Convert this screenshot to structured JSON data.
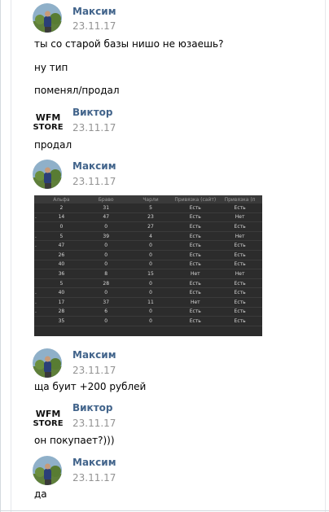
{
  "messages": [
    {
      "author": "Максим",
      "date": "23.11.17",
      "avatar": "maxim",
      "texts": [
        "ты со старой базы нишо не юзаешь?",
        "ну тип",
        "поменял/продал"
      ]
    },
    {
      "author": "Виктор",
      "date": "23.11.17",
      "avatar": "viktor",
      "texts": [
        "продал"
      ]
    },
    {
      "author": "Максим",
      "date": "23.11.17",
      "avatar": "maxim",
      "texts": []
    },
    {
      "author": "Максим",
      "date": "23.11.17",
      "avatar": "maxim",
      "texts": [
        "ща буит +200 рублей"
      ]
    },
    {
      "author": "Виктор",
      "date": "23.11.17",
      "avatar": "viktor",
      "texts": [
        "он покупает?)))"
      ]
    },
    {
      "author": "Максим",
      "date": "23.11.17",
      "avatar": "maxim",
      "texts": [
        "да"
      ]
    }
  ],
  "logo": {
    "line1": "WFM",
    "line2": "STORE"
  },
  "photo_table": {
    "headers": [
      "",
      "Альфа",
      "Браво",
      "Чарли",
      "Привязка (сайт)",
      "Привязка (п"
    ],
    "rows": [
      [
        "",
        "2",
        "31",
        "5",
        "Есть",
        "Есть"
      ],
      [
        ".",
        "14",
        "47",
        "23",
        "Есть",
        "Нет"
      ],
      [
        "",
        "0",
        "0",
        "27",
        "Есть",
        "Есть"
      ],
      [
        ".",
        "5",
        "39",
        "4",
        "Есть",
        "Нет"
      ],
      [
        ".",
        "47",
        "0",
        "0",
        "Есть",
        "Есть"
      ],
      [
        "",
        "26",
        "0",
        "0",
        "Есть",
        "Есть"
      ],
      [
        "",
        "40",
        "0",
        "0",
        "Есть",
        "Есть"
      ],
      [
        "",
        "36",
        "8",
        "15",
        "Нет",
        "Нет"
      ],
      [
        "",
        "5",
        "28",
        "0",
        "Есть",
        "Есть"
      ],
      [
        ".",
        "40",
        "0",
        "0",
        "Есть",
        "Есть"
      ],
      [
        ".",
        "17",
        "37",
        "11",
        "Нет",
        "Есть"
      ],
      [
        ".",
        "28",
        "6",
        "0",
        "Есть",
        "Есть"
      ],
      [
        "",
        "35",
        "0",
        "0",
        "Есть",
        "Есть"
      ]
    ]
  }
}
